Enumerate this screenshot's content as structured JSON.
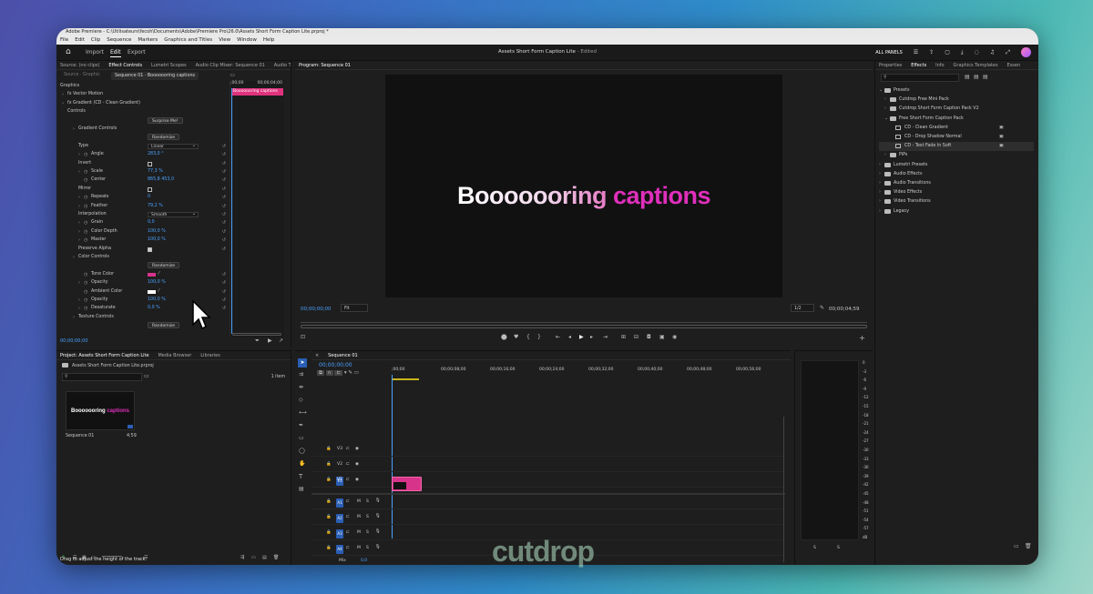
{
  "window": {
    "title": "Adobe Premiere - C:\\Utilisateurs\\fecoh\\Documents\\Adobe\\Premiere Pro\\26.0\\Assets Short Form Caption Lite.prproj *",
    "menu": [
      "File",
      "Edit",
      "Clip",
      "Sequence",
      "Markers",
      "Graphics and Titles",
      "View",
      "Window",
      "Help"
    ]
  },
  "header": {
    "tabs": [
      "Import",
      "Edit",
      "Export"
    ],
    "active_tab": "Edit",
    "project": "Assets Short Form Caption Lite",
    "edited": "- Edited",
    "all_panels": "ALL PANELS"
  },
  "effect_controls": {
    "tabs": [
      "Source: (no clips)",
      "Effect Controls",
      "Lumetri Scopes",
      "Audio Clip Mixer: Sequence 01",
      "Audio Tr"
    ],
    "source_label": "Source · Graphic",
    "sequence_label": "Sequence 01 · Booooooring captions",
    "time_start": ";00;00",
    "time_end": "00;00;04;00",
    "clip_name": "Booooooring captions",
    "rows": [
      {
        "label": "Graphics",
        "indent": 0
      },
      {
        "label": "fx  Vector Motion",
        "indent": 1,
        "tw": true
      },
      {
        "label": "fx  Gradient (CD - Clean Gradient)",
        "indent": 1,
        "tw": true
      },
      {
        "label": "Controls",
        "indent": 2
      },
      {
        "label": "",
        "button": "Surprise Me!",
        "indent": 2
      },
      {
        "label": "Gradient Controls",
        "indent": 3,
        "tw": true
      },
      {
        "label": "",
        "button": "Randomize",
        "indent": 3
      },
      {
        "label": "Type",
        "dropdown": "Linear",
        "indent": 4
      },
      {
        "label": "Angle",
        "value": "283,0 °",
        "indent": 4,
        "tw": true,
        "sw": true
      },
      {
        "label": "Invert",
        "checkbox": false,
        "indent": 4
      },
      {
        "label": "Scale",
        "value": "77,3 %",
        "indent": 4,
        "tw": true,
        "sw": true
      },
      {
        "label": "Center",
        "value": "865,8       453,0",
        "indent": 4,
        "sw": true
      },
      {
        "label": "Mirror",
        "checkbox": false,
        "indent": 4
      },
      {
        "label": "Repeats",
        "value": "0",
        "indent": 4,
        "tw": true,
        "sw": true
      },
      {
        "label": "Feather",
        "value": "79,2 %",
        "indent": 4,
        "tw": true,
        "sw": true
      },
      {
        "label": "Interpolation",
        "dropdown": "Smooth",
        "indent": 4
      },
      {
        "label": "Grain",
        "value": "0,0",
        "indent": 4,
        "tw": true,
        "sw": true
      },
      {
        "label": "Color Depth",
        "value": "100,0 %",
        "indent": 4,
        "tw": true,
        "sw": true
      },
      {
        "label": "Master",
        "value": "100,0 %",
        "indent": 4,
        "tw": true,
        "sw": true
      },
      {
        "label": "Preserve Alpha",
        "checkbox": true,
        "indent": 4
      },
      {
        "label": "Color Controls",
        "indent": 3,
        "tw": true
      },
      {
        "label": "",
        "button": "Randomize",
        "indent": 3
      },
      {
        "label": "Tone Color",
        "swatch": "#d8338a",
        "indent": 4,
        "sw": true
      },
      {
        "label": "Opacity",
        "value": "100,0 %",
        "indent": 4,
        "tw": true,
        "sw": true
      },
      {
        "label": "Ambient Color",
        "swatch": "#ffffff",
        "indent": 4,
        "sw": true
      },
      {
        "label": "Opacity",
        "value": "100,0 %",
        "indent": 4,
        "tw": true,
        "sw": true
      },
      {
        "label": "Desaturate",
        "value": "0,0 %",
        "indent": 4,
        "tw": true,
        "sw": true
      },
      {
        "label": "Texture Controls",
        "indent": 3,
        "tw": true
      },
      {
        "label": "",
        "button": "Randomize",
        "indent": 3
      }
    ],
    "bottom_time": "00;00;00;00"
  },
  "program": {
    "title": "Program: Sequence 01",
    "caption_part1": "Booooooring",
    "caption_part2": " captions",
    "time": "00;00;00;00",
    "fit": "Fit",
    "ratio": "1/2",
    "duration": "00;00;04;59"
  },
  "effects_panel": {
    "tabs": [
      "Properties",
      "Effects",
      "Info",
      "Graphics Templates",
      "Essen"
    ],
    "tree": [
      {
        "label": "Presets",
        "depth": 0,
        "type": "folder",
        "open": true
      },
      {
        "label": "Cutdrop Free Mini Pack",
        "depth": 1,
        "type": "folder"
      },
      {
        "label": "Cutdrop Short Form Caption Pack V2",
        "depth": 1,
        "type": "folder"
      },
      {
        "label": "Free Short Form Caption Pack",
        "depth": 1,
        "type": "folder",
        "open": true
      },
      {
        "label": "CD - Clean Gradient",
        "depth": 2,
        "type": "preset",
        "badge": true
      },
      {
        "label": "CD - Drop Shadow Normal",
        "depth": 2,
        "type": "preset",
        "badge": true
      },
      {
        "label": "CD - Text Fade In Soft",
        "depth": 2,
        "type": "preset",
        "badge": true,
        "selected": true
      },
      {
        "label": "PiPs",
        "depth": 1,
        "type": "folder"
      },
      {
        "label": "Lumetri Presets",
        "depth": 0,
        "type": "folder"
      },
      {
        "label": "Audio Effects",
        "depth": 0,
        "type": "folder"
      },
      {
        "label": "Audio Transitions",
        "depth": 0,
        "type": "folder"
      },
      {
        "label": "Video Effects",
        "depth": 0,
        "type": "folder"
      },
      {
        "label": "Video Transitions",
        "depth": 0,
        "type": "folder"
      },
      {
        "label": "Legacy",
        "depth": 0,
        "type": "folder"
      }
    ]
  },
  "project": {
    "tabs": [
      "Project: Assets Short Form Caption Lite",
      "Media Browser",
      "Libraries"
    ],
    "file": "Assets Short Form Caption Lite.prproj",
    "items": "1 item",
    "thumb_caption1": "Booooooring",
    "thumb_caption2": " captions",
    "seq_name": "Sequence 01",
    "seq_dur": "4;59"
  },
  "timeline": {
    "title": "Sequence 01",
    "time": "00;00;00;00",
    "ruler": [
      ";00;00",
      "00;00;08;00",
      "00;00;16;00",
      "00;00;24;00",
      "00;00;32;00",
      "00;00;40;00",
      "00;00;48;00",
      "00;00;56;00"
    ],
    "video_tracks": [
      "V3",
      "V2",
      "V1"
    ],
    "audio_tracks": [
      "A1",
      "A2",
      "A3",
      "A4"
    ],
    "mix": "Mix",
    "mix_val": "0,0"
  },
  "meter": {
    "ticks": [
      "0",
      "-3",
      "-6",
      "-9",
      "-12",
      "-15",
      "-18",
      "-21",
      "-24",
      "-27",
      "-30",
      "-33",
      "-36",
      "-39",
      "-42",
      "-45",
      "-48",
      "-51",
      "-54",
      "-57",
      "dB"
    ],
    "s1": "S",
    "s2": "S"
  },
  "status": "Drag to adjust the height of the track.",
  "watermark": "cutdrop",
  "colors": {
    "accent": "#2a5fb5",
    "clip": "#d8338a"
  }
}
